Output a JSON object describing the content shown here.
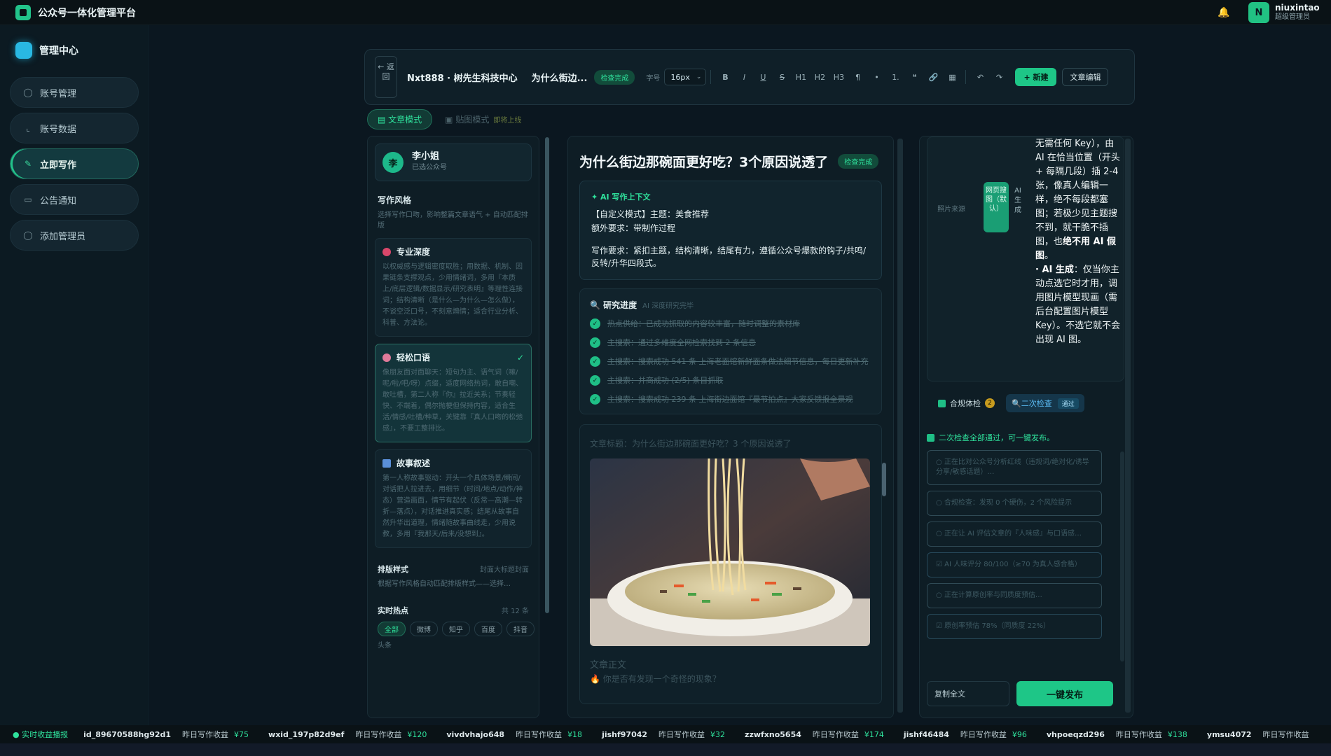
{
  "app": {
    "title": "公众号一体化管理平台"
  },
  "user": {
    "name": "niuxintao",
    "role": "超级管理员",
    "initial": "N"
  },
  "sidebar": {
    "header": "管理中心",
    "items": [
      {
        "label": "账号管理",
        "icon": "user-icon"
      },
      {
        "label": "账号数据",
        "icon": "chart-icon"
      },
      {
        "label": "立即写作",
        "icon": "pen-icon",
        "active": true
      },
      {
        "label": "公告通知",
        "icon": "message-icon"
      },
      {
        "label": "添加管理员",
        "icon": "user-add-icon"
      }
    ]
  },
  "toolbar": {
    "back": "← 返回",
    "account": "Nxt888 · 树先生科技中心",
    "title": "为什么街边...",
    "status": "检查完成",
    "font_size_label": "字号",
    "font_size": "16px",
    "format_buttons": [
      "B",
      "I",
      "U",
      "S",
      "H1",
      "H2",
      "H3",
      "¶",
      "•",
      "1.",
      "❝",
      "🔗",
      "▦",
      "↶",
      "↷"
    ],
    "new_label": "+ 新建",
    "edit_label": "文章编辑"
  },
  "modes": {
    "article": "文章模式",
    "image": "贴图模式",
    "soon": "即将上线"
  },
  "left": {
    "persona_name": "李小姐",
    "persona_sub": "已选公众号",
    "persona_initial": "李",
    "style_header": "写作风格",
    "style_desc": "选择写作口吻，影响整篇文章语气 + 自动匹配排版",
    "styles": [
      {
        "name": "专业深度",
        "desc": "以权威感与逻辑密度取胜；用数据、机制、因果链条支撑观点，少用情绪词，多用『本质上/底层逻辑/数据显示/研究表明』等理性连接词；结构清晰（是什么—为什么—怎么做），不谈空泛口号，不刻意煽情；适合行业分析、科普、方法论。",
        "selected": false
      },
      {
        "name": "轻松口语",
        "desc": "像朋友面对面聊天：短句为主、语气词（嘛/呢/啦/吧/呀）点缀，适度网络热词，敢自嘲、敢吐槽，第二人称『你』拉近关系；节奏轻快、不端着，偶尔抛梗但保持内容，适合生活/情感/吐槽/种草，关键靠『真人口吻的松弛感』，不要工整排比。",
        "selected": true
      },
      {
        "name": "故事叙述",
        "desc": "第一人称故事驱动：开头一个具体场景/瞬间/对话把人拉进去，用细节（时间/地点/动作/神态）营造画面，情节有起伏（反常—高潮—转折—落点），对话推进真实感；结尾从故事自然升华出道理，情绪随故事曲线走，少用说教，多用『我那天/后来/没想到』。",
        "selected": false
      }
    ],
    "layout_header": "排版样式",
    "layout_note": "封面大标题封面",
    "layout_desc": "根据写作风格自动匹配排版样式——选择…",
    "hot_header": "实时热点",
    "hot_count": "共 12 条",
    "hot_tabs": [
      "全部",
      "微博",
      "知乎",
      "百度",
      "抖音"
    ],
    "hot_more": "头条"
  },
  "center": {
    "title": "为什么街边那碗面更好吃？3个原因说透了",
    "status": "检查完成",
    "context_header": "AI 写作上下文",
    "context_lines": [
      "【自定义模式】主题：美食推荐",
      "额外要求：带制作过程",
      "写作要求：紧扣主题，结构清晰，结尾有力，遵循公众号爆款的钩子/共鸣/反转/升华四段式。"
    ],
    "research_header": "研究进度",
    "research_sub": "AI 深度研究完毕",
    "research_steps": [
      "热点供给：已成功抓取的内容较丰富，随时调整的素材库",
      "主搜索：通过多维度全网检索找到 2 条信息",
      "主搜索：搜索成功 541 条 上海老面馆新鲜面条做法细节信息，每日更新补充",
      "主搜索：并商成功 (2/5) 条目抓取",
      "主搜索：搜索成功 239 条 上海街边面馆『最节拍点』大家反馈报全景观"
    ],
    "preview_meta": "文章标题：为什么街边那碗面更好吃？3 个原因说透了",
    "body_head": "文章正文",
    "body_line": "🔥 你是否有发现一个奇怪的现象？"
  },
  "right": {
    "image_source_label": "照片来源",
    "opt_web": "网页搜图（默认）",
    "opt_ai": "AI生成",
    "explain_html_parts": [
      "无需任何 Key），由 AI 在恰当位置（开头 + 每隔几段）插 2-4 张，像真人编辑一样，绝不每段都塞图；若极少见主题搜不到，就干脆不插图，也",
      "绝不用 AI 假图",
      "。",
      "· AI 生成",
      "：仅当你主动点选它时才用，调用图片模型现画（需后台配置图片模型 Key）。不选它就不会出现 AI 图。"
    ],
    "tab_compliance": "合规体检",
    "compliance_badge": "2",
    "tab_recheck": "二次检查",
    "recheck_status": "通过",
    "all_pass": "二次检查全部通过，可一键发布。",
    "logs": [
      "○ 正在比对公众号分析红线（违规词/绝对化/诱导分享/敏感话题）…",
      "○ 合规检查：发现 0 个硬伤，2 个风险提示",
      "○ 正在让 AI 评估文章的『人味感』与口语感…",
      "☑ AI 人味评分 80/100（≥70 为真人感合格）",
      "○ 正在计算原创率与同质度预估…",
      "☑ 原创率预估 78%（同质度 22%）"
    ],
    "copy_label": "复制全文",
    "publish_label": "一键发布"
  },
  "ticker": {
    "live": "实时收益播报",
    "label": "昨日写作收益",
    "entries": [
      {
        "id": "id_89670588hg92d1",
        "amount": "¥75"
      },
      {
        "id": "wxid_197p82d9ef",
        "amount": "¥120"
      },
      {
        "id": "vivdvhajo648",
        "amount": "¥18"
      },
      {
        "id": "jishf97042",
        "amount": "¥32"
      },
      {
        "id": "zzwfxno5654",
        "amount": "¥174"
      },
      {
        "id": "jishf46484",
        "amount": "¥96"
      },
      {
        "id": "vhpoeqzd296",
        "amount": "¥138"
      },
      {
        "id": "ymsu4072",
        "amount": ""
      }
    ]
  },
  "colors": {
    "accent": "#1ec687",
    "bg": "#0b1720",
    "panel": "#0e1d25"
  }
}
